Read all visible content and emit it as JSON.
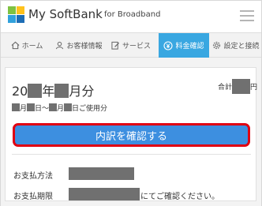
{
  "header": {
    "brand_name": "My SoftBank",
    "brand_sub": "for Broadband",
    "menu_icon": "hamburger-menu-icon",
    "logo_colors": [
      "#7fc241",
      "#ffc21c",
      "#31a1dc",
      "#1d6db5"
    ]
  },
  "nav": {
    "items": [
      {
        "label": "ホーム",
        "icon": "home-icon",
        "active": false
      },
      {
        "label": "お客様情報",
        "icon": "person-icon",
        "active": false
      },
      {
        "label": "サービス",
        "icon": "edit-icon",
        "active": false
      },
      {
        "label": "料金確認",
        "icon": "yen-coin-icon",
        "active": true
      },
      {
        "label": "設定と接続",
        "icon": "gear-icon",
        "active": false
      }
    ],
    "active_color": "#39a7e1"
  },
  "billing": {
    "year_prefix": "20",
    "year_suffix": "年",
    "month_suffix": "月分",
    "total_label": "合計",
    "total_unit": "円",
    "usage_month1_suffix": "月",
    "usage_day1_suffix": "日～",
    "usage_month2_suffix": "月",
    "usage_day2_suffix": "日ご使用分",
    "detail_button": "内訳を確認する",
    "button_color": "#3d8fe0",
    "highlight_color": "#e00012",
    "payment_method_label": "お支払方法",
    "payment_deadline_label": "お支払期限",
    "payment_deadline_suffix": "にてご確認ください。"
  }
}
